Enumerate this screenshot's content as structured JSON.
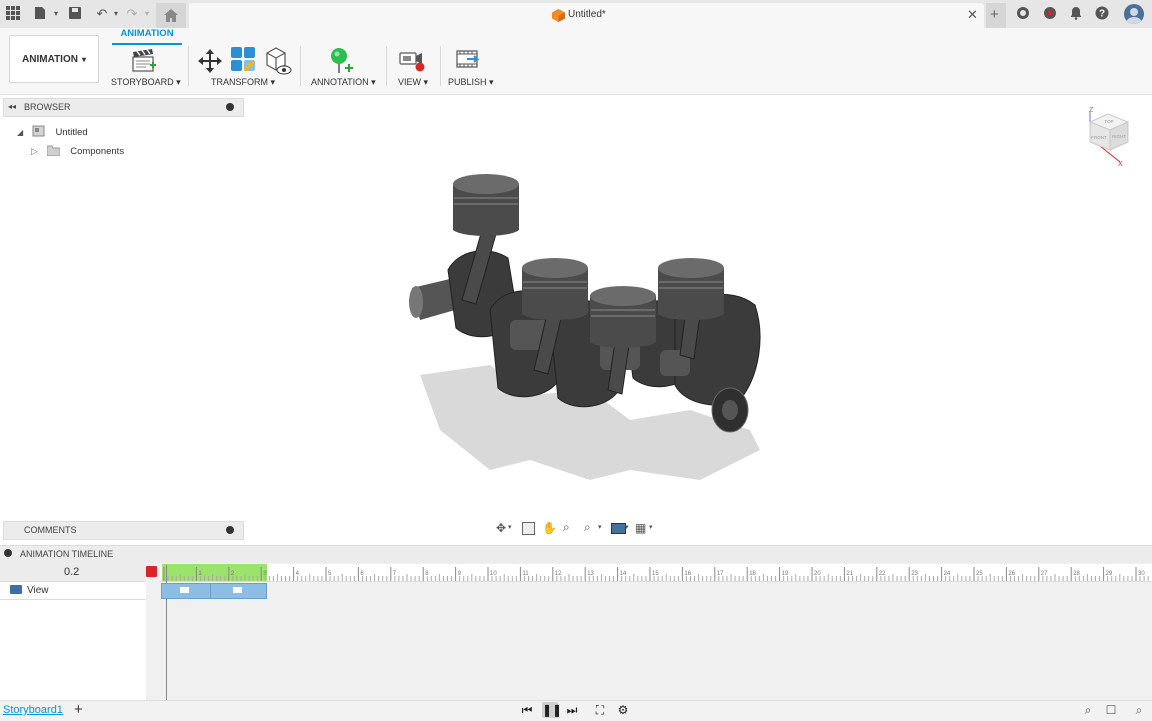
{
  "titlebar": {
    "doc_title": "Untitled*",
    "icons": [
      "apps-grid-icon",
      "file-icon",
      "save-icon",
      "undo-icon",
      "redo-icon",
      "home-icon",
      "close-icon",
      "add-icon",
      "globe-icon",
      "extensions-icon",
      "bell-icon",
      "help-icon",
      "avatar"
    ]
  },
  "toolbar": {
    "workspace_label": "ANIMATION",
    "active_tab": "ANIMATION",
    "groups": [
      {
        "label": "STORYBOARD ▾"
      },
      {
        "label": "TRANSFORM ▾"
      },
      {
        "label": "ANNOTATION ▾"
      },
      {
        "label": "VIEW ▾"
      },
      {
        "label": "PUBLISH ▾"
      }
    ]
  },
  "browser": {
    "title": "BROWSER",
    "root": "Untitled",
    "child": "Components"
  },
  "comments": {
    "title": "COMMENTS"
  },
  "timeline": {
    "title": "ANIMATION TIMELINE",
    "current_time": "0.2",
    "track_label": "View",
    "ruler_ticks": [
      "0",
      "1",
      "2",
      "3",
      "4",
      "5",
      "6",
      "7",
      "8",
      "9",
      "10",
      "11",
      "12",
      "13",
      "14",
      "15",
      "16",
      "17",
      "18",
      "19",
      "20",
      "21",
      "22",
      "23",
      "24",
      "25",
      "26",
      "27",
      "28",
      "29",
      "30"
    ]
  },
  "bottom": {
    "storyboard_tab": "Storyboard1",
    "add_label": "+"
  },
  "viewcube": {
    "face_front": "FRONT",
    "face_right": "RIGHT",
    "face_top": "TOP",
    "axis_z": "Z",
    "axis_x": "X"
  },
  "colors": {
    "accent": "#0696d7",
    "timeline_green": "#9be36a",
    "clip_blue": "#8bbde6",
    "playhead_red": "#d9252a",
    "metal_dark": "#3b3b3b"
  }
}
